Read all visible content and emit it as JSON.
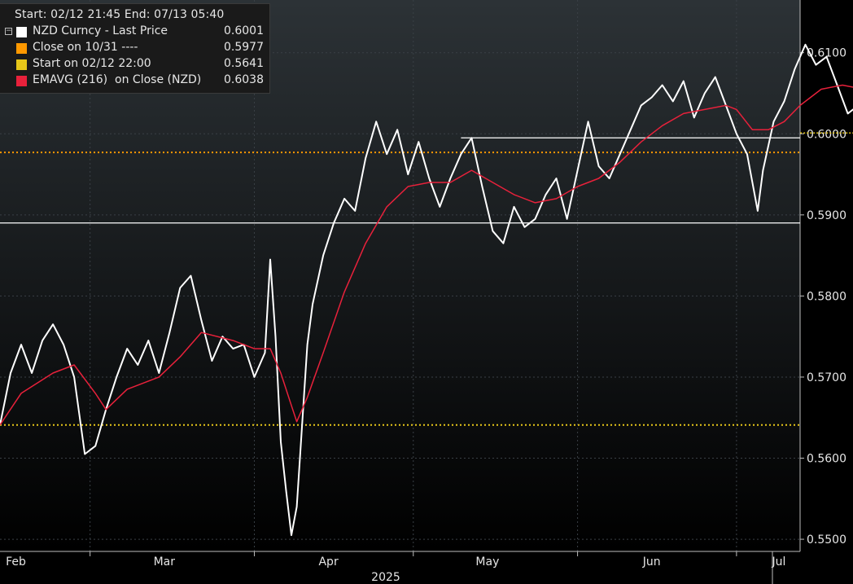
{
  "legend": {
    "header": "Start: 02/12 21:45 End: 07/13 05:40",
    "items": [
      {
        "label": "NZD Curncy - Last Price",
        "value": "0.6001",
        "color": "#ffffff"
      },
      {
        "label": "Close on 10/31 ----",
        "value": "0.5977",
        "color": "#ff9900"
      },
      {
        "label": "Start on 02/12 22:00",
        "value": "0.5641",
        "color": "#e6c619"
      },
      {
        "label": "EMAVG (216)  on Close (NZD)",
        "value": "0.6038",
        "color": "#e8213b"
      }
    ]
  },
  "chart_data": {
    "type": "line",
    "title": "",
    "xlabel": "2025",
    "ylabel": "",
    "x_range": [
      "2025-02-12",
      "2025-07-13"
    ],
    "ylim": [
      0.5485,
      0.6165
    ],
    "y_ticks": [
      "0.5500",
      "0.5600",
      "0.5700",
      "0.5800",
      "0.5900",
      "0.6000",
      "0.6100"
    ],
    "x_tick_labels": [
      {
        "label": "Feb",
        "date": "2025-02-15"
      },
      {
        "label": "Mar",
        "date": "2025-03-15"
      },
      {
        "label": "Apr",
        "date": "2025-04-15"
      },
      {
        "label": "May",
        "date": "2025-05-15"
      },
      {
        "label": "Jun",
        "date": "2025-06-15"
      },
      {
        "label": "Jul",
        "date": "2025-07-09"
      }
    ],
    "year_label": "2025",
    "grid": true,
    "legend_position": "top-left",
    "series": [
      {
        "name": "NZD Curncy - Last Price",
        "color": "#ffffff",
        "points": [
          [
            "2025-02-12",
            0.5641
          ],
          [
            "2025-02-14",
            0.5705
          ],
          [
            "2025-02-16",
            0.574
          ],
          [
            "2025-02-18",
            0.5705
          ],
          [
            "2025-02-20",
            0.5745
          ],
          [
            "2025-02-22",
            0.5765
          ],
          [
            "2025-02-24",
            0.574
          ],
          [
            "2025-02-26",
            0.57
          ],
          [
            "2025-02-28",
            0.5605
          ],
          [
            "2025-03-02",
            0.5615
          ],
          [
            "2025-03-04",
            0.566
          ],
          [
            "2025-03-06",
            0.57
          ],
          [
            "2025-03-08",
            0.5735
          ],
          [
            "2025-03-10",
            0.5715
          ],
          [
            "2025-03-12",
            0.5745
          ],
          [
            "2025-03-14",
            0.5705
          ],
          [
            "2025-03-16",
            0.5755
          ],
          [
            "2025-03-18",
            0.581
          ],
          [
            "2025-03-20",
            0.5825
          ],
          [
            "2025-03-22",
            0.577
          ],
          [
            "2025-03-24",
            0.572
          ],
          [
            "2025-03-26",
            0.575
          ],
          [
            "2025-03-28",
            0.5735
          ],
          [
            "2025-03-30",
            0.574
          ],
          [
            "2025-04-01",
            0.57
          ],
          [
            "2025-04-03",
            0.573
          ],
          [
            "2025-04-04",
            0.5845
          ],
          [
            "2025-04-05",
            0.575
          ],
          [
            "2025-04-06",
            0.562
          ],
          [
            "2025-04-07",
            0.556
          ],
          [
            "2025-04-08",
            0.5505
          ],
          [
            "2025-04-09",
            0.554
          ],
          [
            "2025-04-10",
            0.564
          ],
          [
            "2025-04-11",
            0.574
          ],
          [
            "2025-04-12",
            0.579
          ],
          [
            "2025-04-14",
            0.585
          ],
          [
            "2025-04-16",
            0.589
          ],
          [
            "2025-04-18",
            0.592
          ],
          [
            "2025-04-20",
            0.5905
          ],
          [
            "2025-04-22",
            0.597
          ],
          [
            "2025-04-24",
            0.6015
          ],
          [
            "2025-04-26",
            0.5975
          ],
          [
            "2025-04-28",
            0.6005
          ],
          [
            "2025-04-30",
            0.595
          ],
          [
            "2025-05-02",
            0.599
          ],
          [
            "2025-05-04",
            0.5945
          ],
          [
            "2025-05-06",
            0.591
          ],
          [
            "2025-05-08",
            0.5945
          ],
          [
            "2025-05-10",
            0.5975
          ],
          [
            "2025-05-12",
            0.5995
          ],
          [
            "2025-05-14",
            0.5935
          ],
          [
            "2025-05-16",
            0.588
          ],
          [
            "2025-05-18",
            0.5865
          ],
          [
            "2025-05-20",
            0.591
          ],
          [
            "2025-05-22",
            0.5885
          ],
          [
            "2025-05-24",
            0.5895
          ],
          [
            "2025-05-26",
            0.5925
          ],
          [
            "2025-05-28",
            0.5945
          ],
          [
            "2025-05-30",
            0.5895
          ],
          [
            "2025-06-01",
            0.5955
          ],
          [
            "2025-06-03",
            0.6015
          ],
          [
            "2025-06-05",
            0.596
          ],
          [
            "2025-06-07",
            0.5945
          ],
          [
            "2025-06-09",
            0.5975
          ],
          [
            "2025-06-11",
            0.6005
          ],
          [
            "2025-06-13",
            0.6035
          ],
          [
            "2025-06-15",
            0.6045
          ],
          [
            "2025-06-17",
            0.606
          ],
          [
            "2025-06-19",
            0.604
          ],
          [
            "2025-06-21",
            0.6065
          ],
          [
            "2025-06-23",
            0.602
          ],
          [
            "2025-06-25",
            0.605
          ],
          [
            "2025-06-27",
            0.607
          ],
          [
            "2025-06-29",
            0.6035
          ],
          [
            "2025-07-01",
            0.6
          ],
          [
            "2025-07-03",
            0.5975
          ],
          [
            "2025-07-05",
            0.5905
          ],
          [
            "2025-07-06",
            0.5955
          ],
          [
            "2025-07-08",
            0.6015
          ],
          [
            "2025-07-10",
            0.604
          ],
          [
            "2025-07-12",
            0.608
          ],
          [
            "2025-07-14",
            0.611
          ],
          [
            "2025-07-16",
            0.6085
          ],
          [
            "2025-07-18",
            0.6095
          ],
          [
            "2025-07-20",
            0.606
          ],
          [
            "2025-07-22",
            0.6025
          ],
          [
            "2025-07-24",
            0.6035
          ],
          [
            "2025-07-26",
            0.602
          ],
          [
            "2025-07-28",
            0.5995
          ],
          [
            "2025-07-30",
            0.601
          ],
          [
            "2025-08-01",
            0.5985
          ],
          [
            "2025-08-02",
            0.6001
          ]
        ]
      },
      {
        "name": "EMAVG (216)  on Close (NZD)",
        "color": "#e8213b",
        "points": [
          [
            "2025-02-12",
            0.5641
          ],
          [
            "2025-02-16",
            0.568
          ],
          [
            "2025-02-22",
            0.5705
          ],
          [
            "2025-02-26",
            0.5715
          ],
          [
            "2025-03-02",
            0.568
          ],
          [
            "2025-03-04",
            0.566
          ],
          [
            "2025-03-08",
            0.5685
          ],
          [
            "2025-03-14",
            0.57
          ],
          [
            "2025-03-18",
            0.5725
          ],
          [
            "2025-03-22",
            0.5755
          ],
          [
            "2025-03-28",
            0.5745
          ],
          [
            "2025-04-01",
            0.5735
          ],
          [
            "2025-04-04",
            0.5735
          ],
          [
            "2025-04-06",
            0.5705
          ],
          [
            "2025-04-08",
            0.5665
          ],
          [
            "2025-04-09",
            0.5645
          ],
          [
            "2025-04-11",
            0.5675
          ],
          [
            "2025-04-14",
            0.573
          ],
          [
            "2025-04-18",
            0.5805
          ],
          [
            "2025-04-22",
            0.5865
          ],
          [
            "2025-04-26",
            0.591
          ],
          [
            "2025-04-30",
            0.5935
          ],
          [
            "2025-05-04",
            0.594
          ],
          [
            "2025-05-08",
            0.594
          ],
          [
            "2025-05-12",
            0.5955
          ],
          [
            "2025-05-16",
            0.594
          ],
          [
            "2025-05-20",
            0.5925
          ],
          [
            "2025-05-24",
            0.5915
          ],
          [
            "2025-05-28",
            0.592
          ],
          [
            "2025-06-01",
            0.5935
          ],
          [
            "2025-06-05",
            0.5945
          ],
          [
            "2025-06-09",
            0.5965
          ],
          [
            "2025-06-13",
            0.599
          ],
          [
            "2025-06-17",
            0.601
          ],
          [
            "2025-06-21",
            0.6025
          ],
          [
            "2025-06-25",
            0.603
          ],
          [
            "2025-06-29",
            0.6035
          ],
          [
            "2025-07-01",
            0.603
          ],
          [
            "2025-07-04",
            0.6005
          ],
          [
            "2025-07-07",
            0.6005
          ],
          [
            "2025-07-10",
            0.6015
          ],
          [
            "2025-07-13",
            0.6035
          ],
          [
            "2025-07-17",
            0.6055
          ],
          [
            "2025-07-21",
            0.606
          ],
          [
            "2025-07-25",
            0.6055
          ],
          [
            "2025-07-29",
            0.6045
          ],
          [
            "2025-08-02",
            0.6038
          ]
        ]
      }
    ],
    "reference_lines": [
      {
        "name": "Close on 10/31",
        "value": 0.5977,
        "color": "#ff9900",
        "style": "dotted"
      },
      {
        "name": "Start on 02/12 22:00",
        "value": 0.5641,
        "color": "#e6c619",
        "style": "dotted"
      },
      {
        "value": 0.589,
        "color": "#ffffff",
        "style": "solid"
      },
      {
        "value": 0.5995,
        "color": "#ffffff",
        "style": "solid",
        "from": "2025-05-10"
      }
    ]
  }
}
